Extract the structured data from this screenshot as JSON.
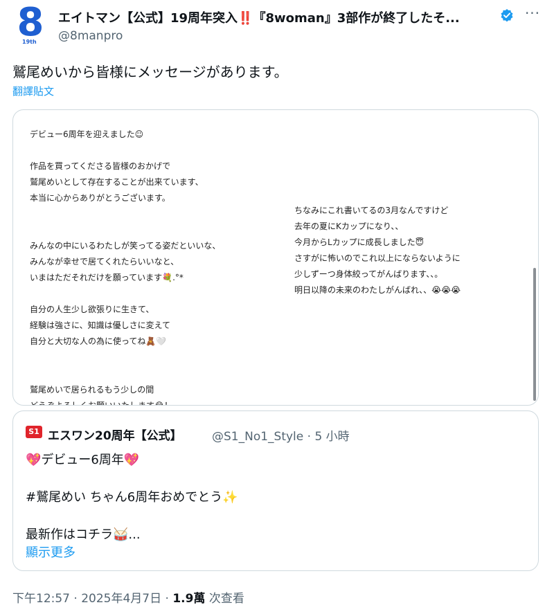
{
  "header": {
    "avatar_text": "8",
    "avatar_sub": "19th",
    "display_name": "エイトマン【公式】19周年突入‼️『8woman』3部作が終了したそ...",
    "handle": "@8manpro",
    "more_label": "···"
  },
  "tweet": {
    "text": "鷲尾めいから皆様にメッセージがあります。",
    "translate_label": "翻譯貼文"
  },
  "note": {
    "left_lines": [
      "デビュー6周年を迎えました☺︎",
      "作品を買ってくださる皆様のおかげで",
      "鷲尾めいとして存在することが出来ています、",
      "本当に心からありがとうございます。",
      "みんなの中にいるわたしが笑ってる姿だといいな、",
      "みんなが幸せで居てくれたらいいなと、",
      "いまはただそれだけを願っています💐.°*",
      "自分の人生少し欲張りに生きて、",
      "経験は強さに、知識は優しさに変えて",
      "自分と大切な人の為に使ってね🧸🤍",
      "鷲尾めいで居られるもう少しの間",
      "どうぞよろしくお願いいたします😂！"
    ],
    "right_lines": [
      "ちなみにこれ書いてるの3月なんですけど",
      "去年の夏にKカップになり、、",
      "今月からLカップに成長しました😇",
      "さすがに怖いのでこれ以上にならないように",
      "少しずーつ身体絞ってがんばります、、。",
      "明日以降の未来のわたしがんばれ、、😭😭😭"
    ]
  },
  "quote": {
    "logo_text": "S1",
    "name": "エスワン20周年【公式】",
    "meta": "@S1_No1_Style · 5 小時",
    "line1": "💖デビュー6周年💖",
    "line2": "#鷲尾めい ちゃん6周年おめでとう✨",
    "line3": "最新作はコチラ🥁...",
    "show_more": "顯示更多"
  },
  "footer": {
    "timestamp": "下午12:57 · 2025年4月7日 · ",
    "views_count": "1.9萬",
    "views_label": " 次查看"
  },
  "colors": {
    "accent": "#1d9bf0",
    "brand": "#1f5fd1",
    "s1_red": "#e0242b",
    "muted": "#536471"
  }
}
